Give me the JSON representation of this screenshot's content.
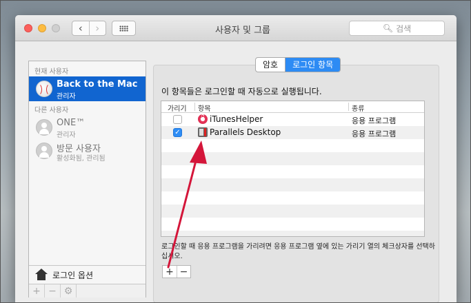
{
  "window": {
    "title": "사용자 및 그룹",
    "search_placeholder": "검색",
    "back_glyph": "‹",
    "forward_glyph": "›"
  },
  "sidebar": {
    "current_header": "현재 사용자",
    "other_header": "다른 사용자",
    "current_user": {
      "name": "Back to the Mac",
      "role": "관리자",
      "selected": true
    },
    "other_users": [
      {
        "name": "ONE™",
        "role": "관리자"
      },
      {
        "name": "방문 사용자",
        "role": "활성화됨, 관리됨"
      }
    ],
    "login_options_label": "로그인 옵션",
    "tools": {
      "add": "+",
      "remove": "−",
      "settings": "⚙"
    }
  },
  "tabs": [
    {
      "label": "암호",
      "active": false
    },
    {
      "label": "로그인 항목",
      "active": true
    }
  ],
  "login_items": {
    "description": "이 항목들은 로그인할 때 자동으로 실행됩니다.",
    "columns": {
      "hide": "가리기",
      "item": "항목",
      "kind": "종류"
    },
    "rows": [
      {
        "hidden": false,
        "icon": "itunes-icon",
        "name": "iTunesHelper",
        "kind": "응용 프로그램"
      },
      {
        "hidden": true,
        "icon": "parallels-icon",
        "name": "Parallels Desktop",
        "kind": "응용 프로그램"
      }
    ],
    "hint": "로그인할 때 응용 프로그램을 가리려면 응용 프로그램 옆에 있는 가리기 열의 체크상자를 선택하십시오.",
    "add_label": "+",
    "remove_label": "−",
    "checkmark": "✓"
  },
  "annotation": {
    "color": "#d4163a"
  }
}
